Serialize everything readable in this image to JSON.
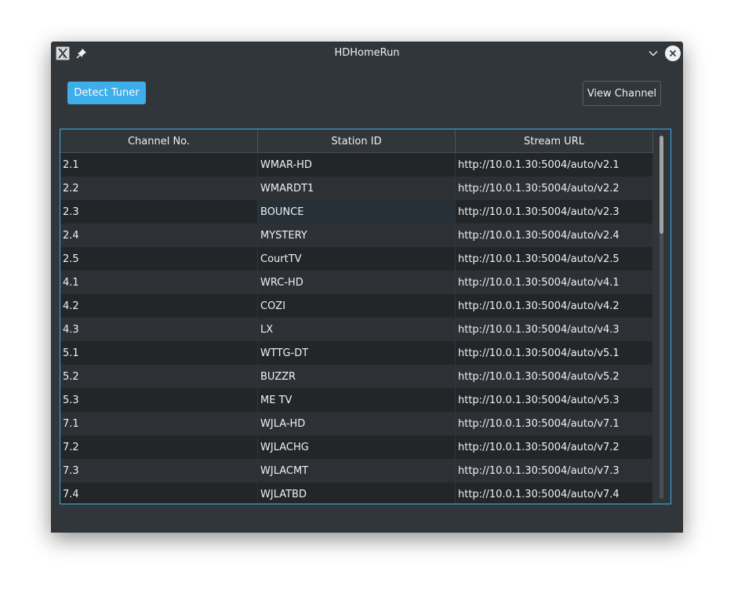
{
  "window": {
    "title": "HDHomeRun"
  },
  "toolbar": {
    "detect_label": "Detect Tuner",
    "view_label": "View Channel"
  },
  "table": {
    "headers": [
      "Channel No.",
      "Station ID",
      "Stream URL"
    ],
    "rows": [
      [
        "2.1",
        "WMAR-HD",
        "http://10.0.1.30:5004/auto/v2.1"
      ],
      [
        "2.2",
        "WMARDT1",
        "http://10.0.1.30:5004/auto/v2.2"
      ],
      [
        "2.3",
        "BOUNCE",
        "http://10.0.1.30:5004/auto/v2.3"
      ],
      [
        "2.4",
        "MYSTERY",
        "http://10.0.1.30:5004/auto/v2.4"
      ],
      [
        "2.5",
        "CourtTV",
        "http://10.0.1.30:5004/auto/v2.5"
      ],
      [
        "4.1",
        "WRC-HD",
        "http://10.0.1.30:5004/auto/v4.1"
      ],
      [
        "4.2",
        "COZI",
        "http://10.0.1.30:5004/auto/v4.2"
      ],
      [
        "4.3",
        "LX",
        "http://10.0.1.30:5004/auto/v4.3"
      ],
      [
        "5.1",
        "WTTG-DT",
        "http://10.0.1.30:5004/auto/v5.1"
      ],
      [
        "5.2",
        "BUZZR",
        "http://10.0.1.30:5004/auto/v5.2"
      ],
      [
        "5.3",
        "ME TV",
        "http://10.0.1.30:5004/auto/v5.3"
      ],
      [
        "7.1",
        "WJLA-HD",
        "http://10.0.1.30:5004/auto/v7.1"
      ],
      [
        "7.2",
        "WJLACHG",
        "http://10.0.1.30:5004/auto/v7.2"
      ],
      [
        "7.3",
        "WJLACMT",
        "http://10.0.1.30:5004/auto/v7.3"
      ],
      [
        "7.4",
        "WJLATBD",
        "http://10.0.1.30:5004/auto/v7.4"
      ]
    ]
  },
  "icons": {
    "app": "x-app-icon",
    "pin": "pin-icon",
    "minimize": "chevron-down-icon",
    "close": "close-icon"
  },
  "colors": {
    "accent": "#3daee9",
    "window_bg": "#31363b",
    "row_dark": "#232629",
    "row_light": "#2d3136"
  }
}
